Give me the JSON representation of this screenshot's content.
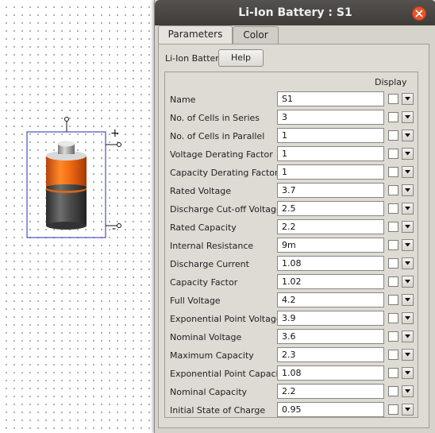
{
  "window": {
    "title": "Li-Ion Battery : S1"
  },
  "tabs": [
    {
      "label": "Parameters"
    },
    {
      "label": "Color"
    }
  ],
  "section": {
    "label": "Li-Ion Battery",
    "help_label": "Help",
    "display_header": "Display"
  },
  "schematic": {
    "plus": "+",
    "minus": "-"
  },
  "params": [
    {
      "label": "Name",
      "value": "S1"
    },
    {
      "label": "No. of Cells in Series",
      "value": "3"
    },
    {
      "label": "No. of Cells in Parallel",
      "value": "1"
    },
    {
      "label": "Voltage Derating Factor",
      "value": "1"
    },
    {
      "label": "Capacity Derating Factor",
      "value": "1"
    },
    {
      "label": "Rated Voltage",
      "value": "3.7"
    },
    {
      "label": "Discharge Cut-off Voltage",
      "value": "2.5"
    },
    {
      "label": "Rated Capacity",
      "value": "2.2"
    },
    {
      "label": "Internal Resistance",
      "value": "9m"
    },
    {
      "label": "Discharge Current",
      "value": "1.08"
    },
    {
      "label": "Capacity Factor",
      "value": "1.02"
    },
    {
      "label": "Full Voltage",
      "value": "4.2"
    },
    {
      "label": "Exponential Point Voltage",
      "value": "3.9"
    },
    {
      "label": "Nominal Voltage",
      "value": "3.6"
    },
    {
      "label": "Maximum Capacity",
      "value": "2.3"
    },
    {
      "label": "Exponential Point Capacity",
      "value": "1.08"
    },
    {
      "label": "Nominal Capacity",
      "value": "2.2"
    },
    {
      "label": "Initial State of Charge",
      "value": "0.95"
    }
  ]
}
